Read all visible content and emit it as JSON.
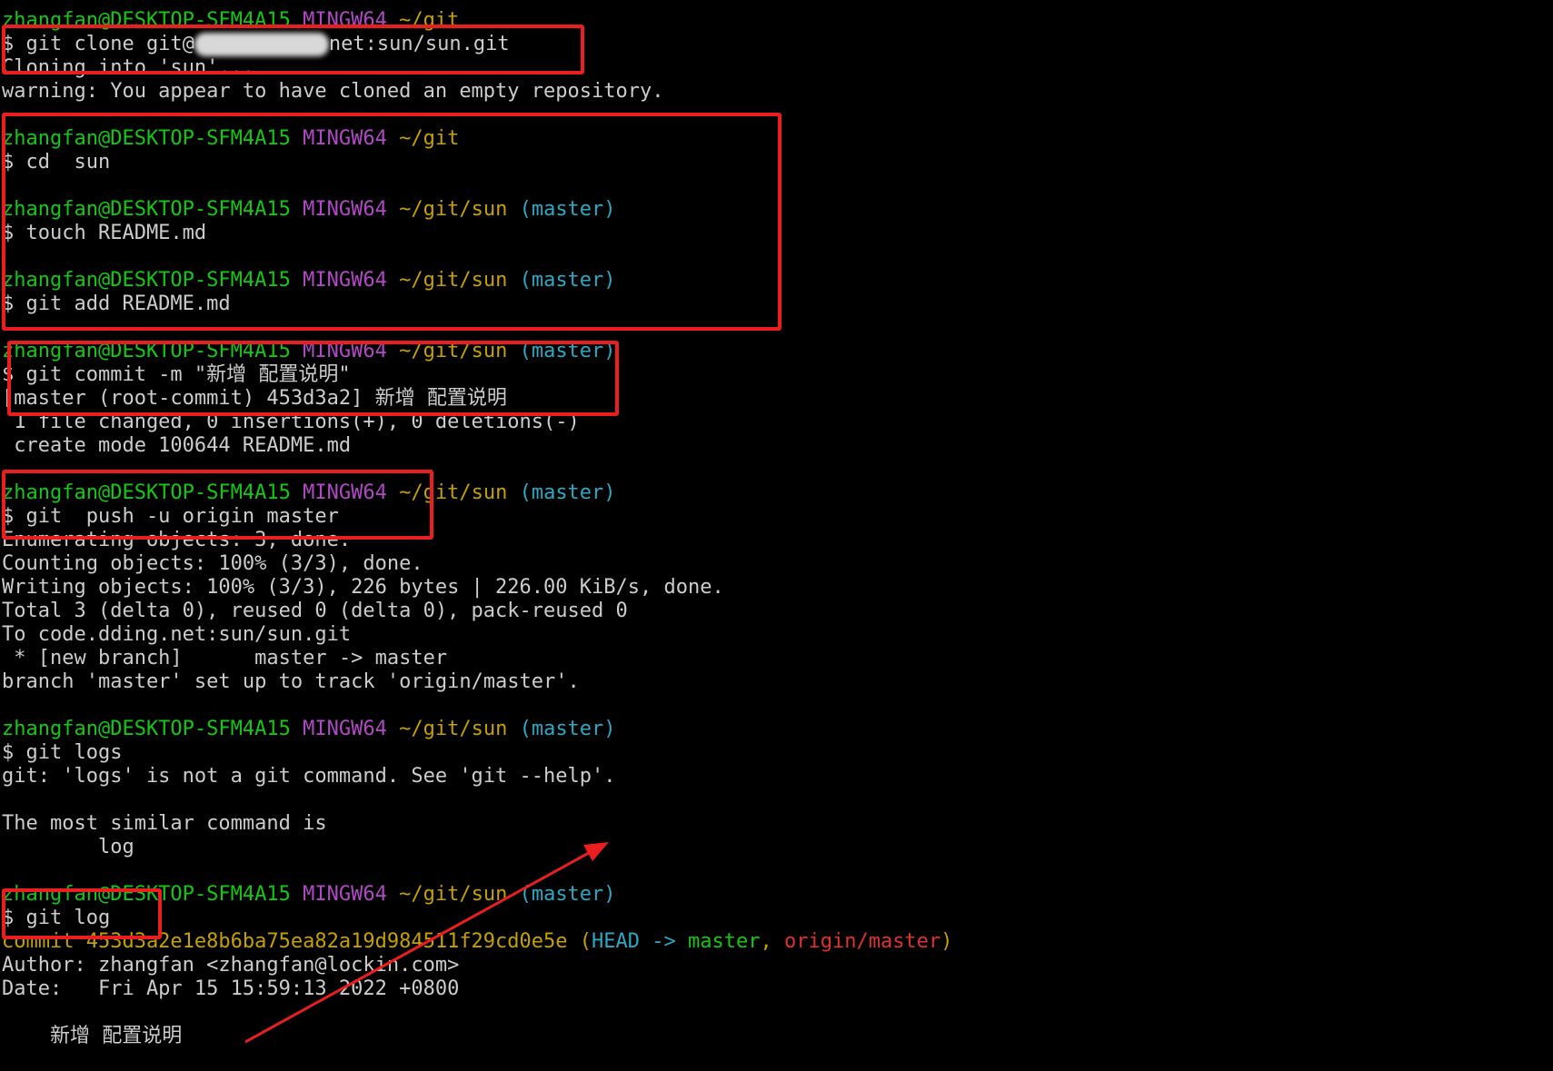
{
  "prompt": {
    "user_host": "zhangfan@DESKTOP-SFM4A15",
    "shell": "MINGW64",
    "path_git": "~/git",
    "path_sun": "~/git/sun",
    "branch": "(master)"
  },
  "session": {
    "clone_cmd_pre": "$ git clone git@",
    "clone_cmd_post": "net:sun/sun.git",
    "cloning_into": "Cloning into 'sun'...",
    "clone_warning": "warning: You appear to have cloned an empty repository.",
    "cd_cmd": "$ cd  sun",
    "touch_cmd": "$ touch README.md",
    "add_cmd": "$ git add README.md",
    "commit_cmd": "$ git commit -m \"新增 配置说明\"",
    "commit_result": "[master (root-commit) 453d3a2] 新增 配置说明",
    "commit_stat": " 1 file changed, 0 insertions(+), 0 deletions(-)",
    "commit_mode": " create mode 100644 README.md",
    "push_cmd": "$ git  push -u origin master",
    "push_enum": "Enumerating objects: 3, done.",
    "push_count": "Counting objects: 100% (3/3), done.",
    "push_write": "Writing objects: 100% (3/3), 226 bytes | 226.00 KiB/s, done.",
    "push_total": "Total 3 (delta 0), reused 0 (delta 0), pack-reused 0",
    "push_to": "To code.dding.net:sun/sun.git",
    "push_branch": " * [new branch]      master -> master",
    "push_track": "branch 'master' set up to track 'origin/master'.",
    "logs_cmd": "$ git logs",
    "logs_error": "git: 'logs' is not a git command. See 'git --help'.",
    "similar_header": "The most similar command is",
    "similar_cmd": "        log",
    "log_cmd": "$ git log",
    "log_commit_label": "commit 453d3a2e1e8b6ba75ea82a19d984511f29cd0e5e",
    "log_paren_open": "(",
    "log_head": "HEAD ->",
    "log_local": "master",
    "log_comma": ",",
    "log_remote": "origin/master",
    "log_paren_close": ")",
    "log_author": "Author: zhangfan <zhangfan@lockin.com>",
    "log_date": "Date:   Fri Apr 15 15:59:13 2022 +0800",
    "log_message": "    新增 配置说明"
  },
  "colors": {
    "background": "#000000",
    "text": "#cccccc",
    "prompt_user": "#13c813",
    "prompt_shell": "#b148c6",
    "prompt_path": "#c4a000",
    "prompt_branch": "#2aa8c4",
    "annotation": "#ea1e1e"
  }
}
